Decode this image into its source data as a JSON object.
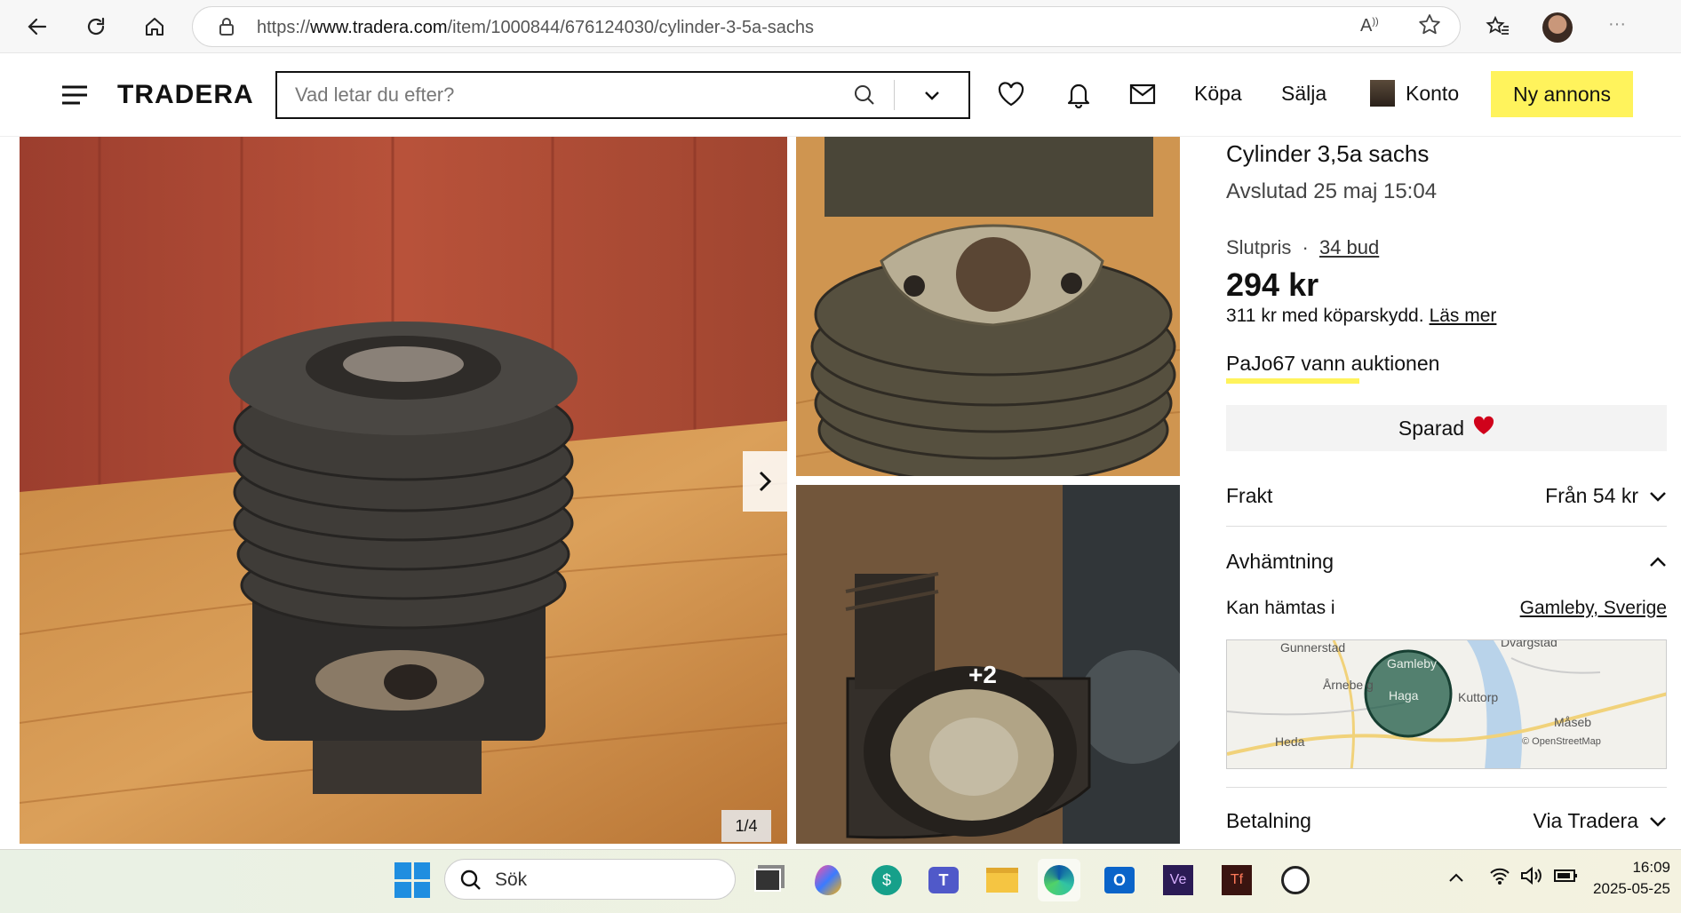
{
  "browser": {
    "url_prefix": "https://",
    "url_domain": "www.tradera.com",
    "url_path": "/item/1000844/676124030/cylinder-3-5a-sachs",
    "more_label": "···"
  },
  "header": {
    "logo": "TRADERA",
    "search_placeholder": "Vad letar du efter?",
    "nav": {
      "buy": "Köpa",
      "sell": "Sälja",
      "account": "Konto",
      "new_listing": "Ny annons"
    }
  },
  "gallery": {
    "counter": "1/4",
    "more_badge": "+2"
  },
  "item": {
    "title": "Cylinder 3,5a sachs",
    "ended": "Avslutad 25 maj 15:04",
    "final_price_label": "Slutpris",
    "separator": "·",
    "bids": "34 bud",
    "price": "294 kr",
    "buyer_protection": "311 kr med köparskydd.",
    "read_more": "Läs mer",
    "winner": "PaJo67 vann auktionen",
    "saved_label": "Sparad",
    "shipping_label": "Frakt",
    "shipping_value": "Från 54 kr",
    "pickup_label": "Avhämtning",
    "pickup_text": "Kan hämtas i",
    "pickup_location": "Gamleby, Sverige",
    "payment_label": "Betalning",
    "payment_value": "Via Tradera"
  },
  "map": {
    "labels": [
      "Gunnerstad",
      "Dvärgstad",
      "Gamleby",
      "Årnebe g",
      "Haga",
      "Kuttorp",
      "Måseb",
      "Heda"
    ],
    "attribution": "© OpenStreetMap"
  },
  "taskbar": {
    "search_label": "Sök",
    "time": "16:09",
    "date": "2025-05-25"
  },
  "colors": {
    "brand_yellow": "#fff35c",
    "heart_red": "#d0021b"
  }
}
